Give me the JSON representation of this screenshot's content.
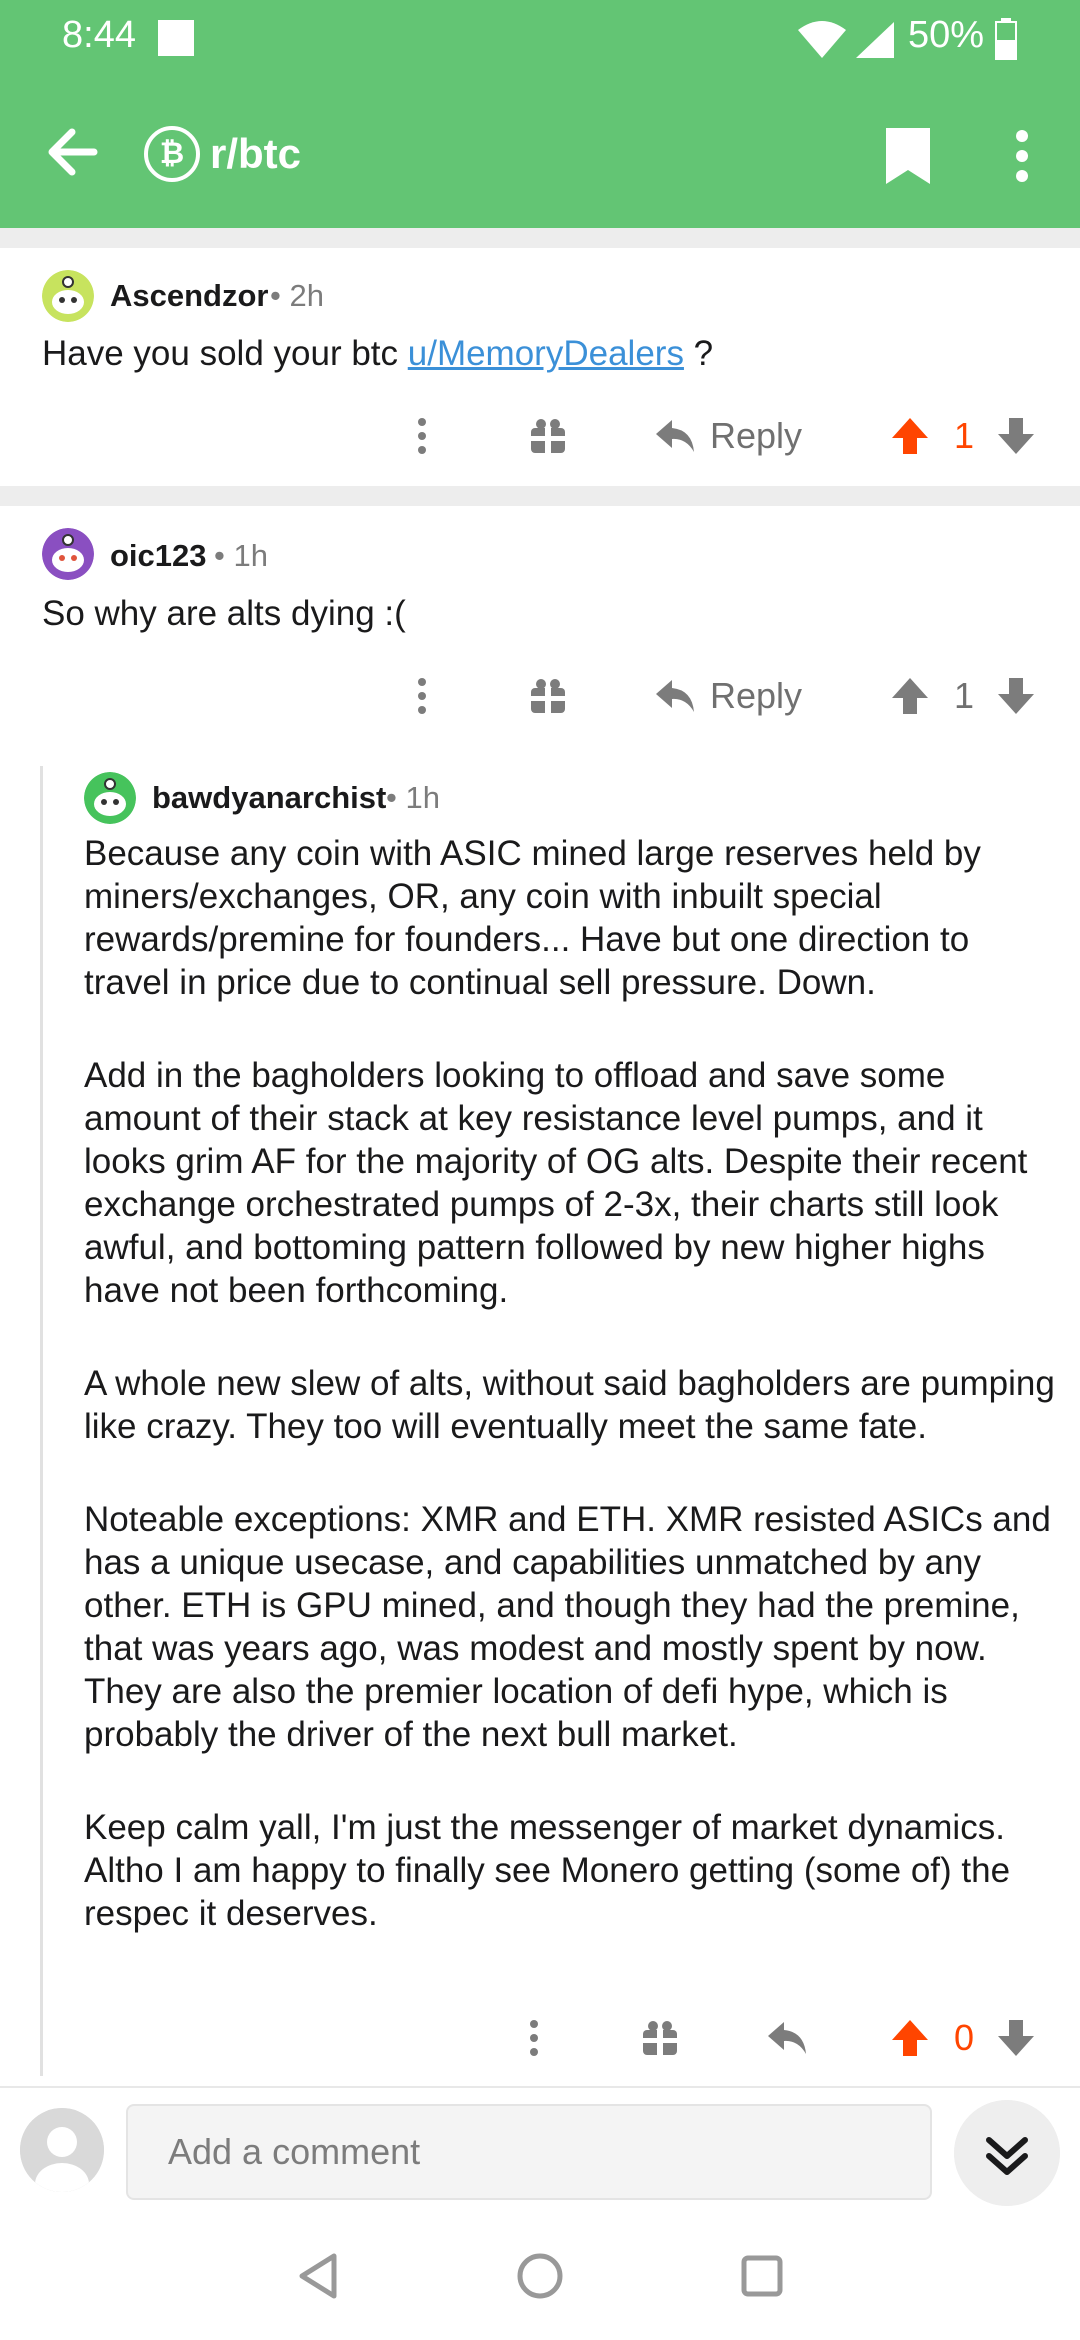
{
  "status_bar": {
    "time": "8:44",
    "battery": "50%"
  },
  "app_bar": {
    "subreddit": "r/btc",
    "sub_icon_glyph": "₿",
    "bookmark_icon": "bookmark-icon",
    "more_icon": "more-vertical-icon"
  },
  "colors": {
    "brand_green": "#63c574",
    "upvote_orange": "#ff4500",
    "link_blue": "#3b90d8",
    "meta_gray": "#7c7c7c"
  },
  "comments": [
    {
      "author": "Ascendzor",
      "time": "2h",
      "text_before_link": "Have you sold your btc ",
      "link": "u/MemoryDealers",
      "text_after_link": " ?",
      "reply_label": "Reply",
      "score": "1"
    },
    {
      "author": "oic123",
      "time": "1h",
      "text": "So why are alts dying :(",
      "reply_label": "Reply",
      "score": "1"
    },
    {
      "author": "bawdyanarchist",
      "time": "1h",
      "paragraphs": [
        "Because any coin with ASIC mined large reserves held by miners/exchanges, OR, any coin with inbuilt special rewards/premine for founders... Have but one direction to travel in price due to continual sell pressure. Down.",
        "Add in the bagholders looking to offload and save some amount of their stack at key resistance level pumps, and it looks grim AF for the majority of OG alts.  Despite their recent exchange orchestrated pumps of 2-3x, their charts still look awful, and bottoming pattern followed by new higher highs have not been forthcoming.",
        "A whole new slew of alts, without said bagholders are pumping like crazy. They too will eventually meet the same fate.",
        "Noteable exceptions:  XMR and ETH.  XMR resisted ASICs and has a unique usecase, and capabilities unmatched by any other.  ETH is GPU mined, and though they had the premine, that was years ago, was modest and mostly spent by now.  They are also the premier location of defi hype, which is probably the driver of the next bull market.",
        "Keep calm yall, I'm just the messenger of market dynamics. Altho I am happy to finally see Monero getting (some of) the respec it deserves."
      ],
      "score": "0"
    }
  ],
  "compose": {
    "placeholder": "Add a comment"
  }
}
